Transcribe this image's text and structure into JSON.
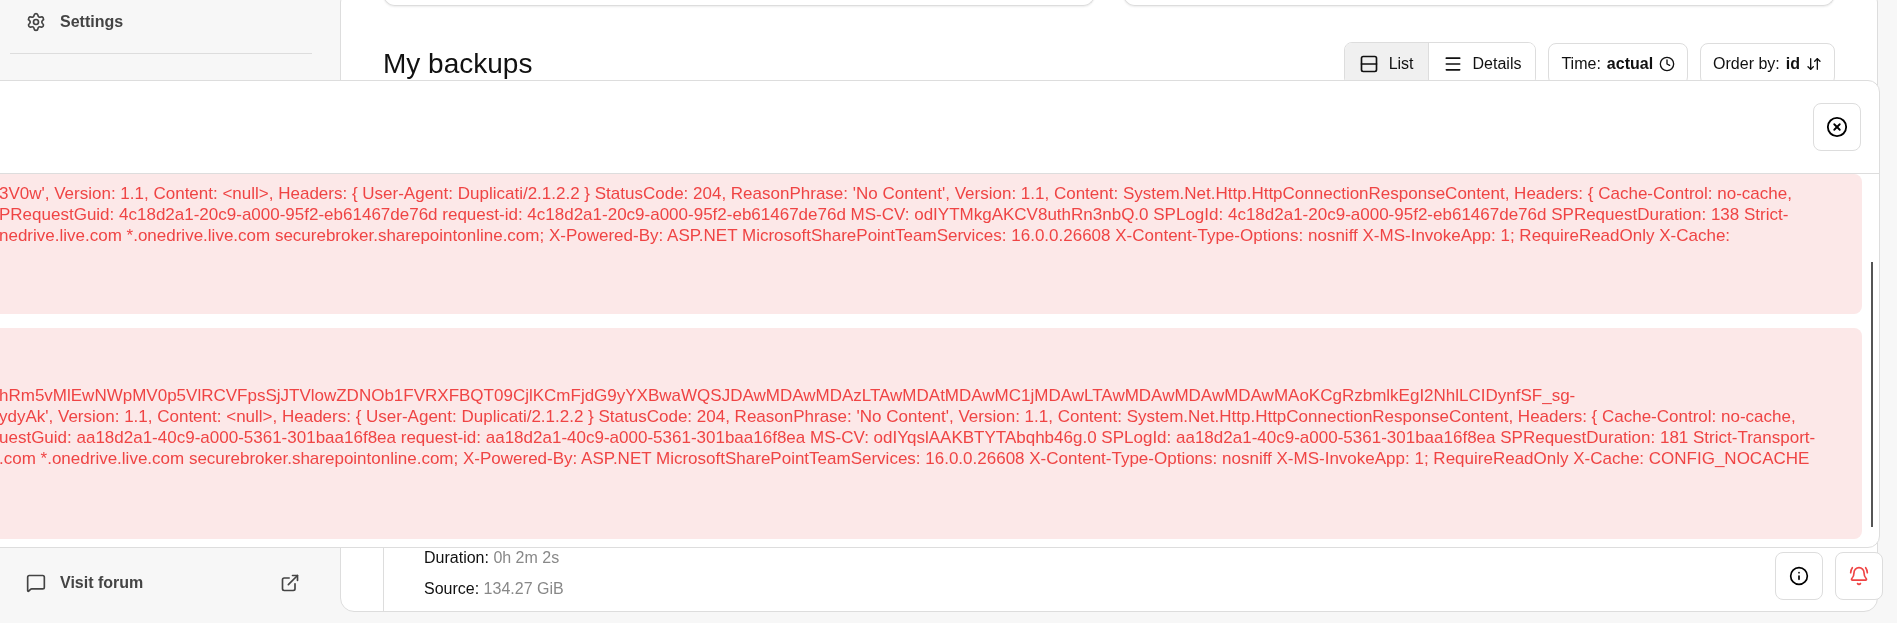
{
  "sidebar": {
    "items": [
      {
        "label": "Settings"
      }
    ],
    "footer_link": {
      "label": "Visit forum"
    }
  },
  "main": {
    "title": "My backups",
    "view_toggle": [
      {
        "label": "List",
        "selected": true
      },
      {
        "label": "Details",
        "selected": false
      }
    ],
    "time_button": {
      "label": "Time:",
      "value": "actual"
    },
    "order_button": {
      "label": "Order by:",
      "value": "id"
    },
    "details": [
      {
        "label": "Duration:",
        "value": "0h 2m 2s"
      },
      {
        "label": "Source:",
        "value": "134.27 GiB"
      }
    ]
  },
  "dialog": {
    "messages": [
      {
        "lines": [
          "3V0w', Version: 1.1, Content: <null>, Headers: { User-Agent: Duplicati/2.1.2.2 } StatusCode: 204, ReasonPhrase: 'No Content', Version: 1.1, Content: System.Net.Http.HttpConnectionResponseContent, Headers: { Cache-Control: no-cache,",
          "PRequestGuid: 4c18d2a1-20c9-a000-95f2-eb61467de76d request-id: 4c18d2a1-20c9-a000-95f2-eb61467de76d MS-CV: odIYTMkgAKCV8uthRn3nbQ.0 SPLogId: 4c18d2a1-20c9-a000-95f2-eb61467de76d SPRequestDuration: 138 Strict-",
          "nedrive.live.com *.onedrive.live.com securebroker.sharepointonline.com; X-Powered-By: ASP.NET MicrosoftSharePointTeamServices: 16.0.0.26608 X-Content-Type-Options: nosniff X-MS-InvokeApp: 1; RequireReadOnly X-Cache:"
        ]
      },
      {
        "lines": [
          "hRm5vMlEwNWpMV0p5VlRCVFpsSjJTVlowZDNOb1FVRXFBQT09CjlKCmFjdG9yYXBwaWQSJDAwMDAwMDAzLTAwMDAtMDAwMC1jMDAwLTAwMDAwMDAwMDAwMAoKCgRzbmlkEgI2NhlLCIDynfSF_sg-",
          "ydyAk', Version: 1.1, Content: <null>, Headers: { User-Agent: Duplicati/2.1.2.2 } StatusCode: 204, ReasonPhrase: 'No Content', Version: 1.1, Content: System.Net.Http.HttpConnectionResponseContent, Headers: { Cache-Control: no-cache,",
          "uestGuid: aa18d2a1-40c9-a000-5361-301baa16f8ea request-id: aa18d2a1-40c9-a000-5361-301baa16f8ea MS-CV: odIYqslAAKBTYTAbqhb46g.0 SPLogId: aa18d2a1-40c9-a000-5361-301baa16f8ea SPRequestDuration: 181 Strict-Transport-",
          ".com *.onedrive.live.com securebroker.sharepointonline.com; X-Powered-By: ASP.NET MicrosoftSharePointTeamServices: 16.0.0.26608 X-Content-Type-Options: nosniff X-MS-InvokeApp: 1; RequireReadOnly X-Cache: CONFIG_NOCACHE"
        ]
      }
    ]
  }
}
